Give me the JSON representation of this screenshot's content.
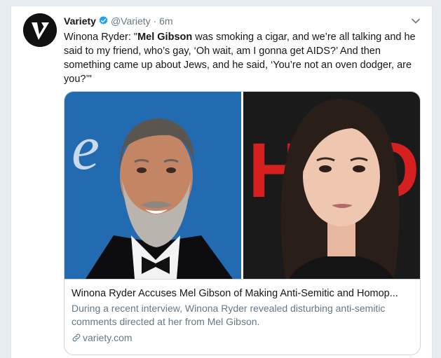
{
  "tweet": {
    "author_name": "Variety",
    "author_handle": "@Variety",
    "separator": "·",
    "time": "6m",
    "text_prefix": "Winona Ryder: \"",
    "text_bold": "Mel Gibson",
    "text_rest": " was smoking a cigar, and we’re all talking and he said to my friend, who’s gay, ‘Oh wait, am I gonna get AIDS?’ And then something came up about Jews, and he said, ‘You’re not an oven dodger, are you?’\""
  },
  "link_card": {
    "title": "Winona Ryder Accuses Mel Gibson of Making Anti-Semitic and Homop...",
    "description": "During a recent interview, Winona Ryder revealed disturbing anti-semitic comments directed at her from Mel Gibson.",
    "domain": "variety.com",
    "left_backdrop_text": "e",
    "right_backdrop_text": "HBO"
  },
  "icons": {
    "avatar": "variety-v-logo",
    "verified": "verified-badge-icon",
    "menu": "chevron-down-icon",
    "link": "link-icon"
  },
  "colors": {
    "verified": "#1da1f2",
    "secondary_text": "#657786",
    "border": "#ccd6dd",
    "left_backdrop": "#1f63a8",
    "right_backdrop": "#d61f1f"
  }
}
